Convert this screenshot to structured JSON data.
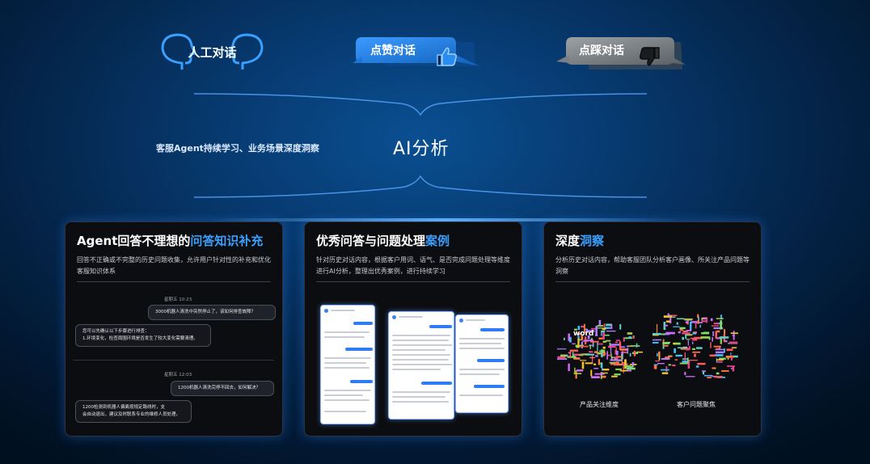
{
  "top": {
    "human_label": "人工对话",
    "like_label": "点赞对话",
    "dislike_label": "点踩对话"
  },
  "middle": {
    "agent_caption": "客服Agent持续学习、业务场景深度洞察",
    "ai_title": "AI分析"
  },
  "cards": [
    {
      "title_plain": "Agent回答不理想的",
      "title_highlight": "问答知识补充",
      "desc": "回答不正确或不完整的历史问题收集，允许用户针对性的补充和优化客服知识体系",
      "chat": {
        "time1": "星期五 10:23",
        "user1": "3000机器人清洗中突然停止了，该如何排查故障？",
        "bot1_line1": "您可以先确认以下步骤进行排查：",
        "bot1_line2": "1.环境变化，检查周围环境是否发生了较大变化需要清理。",
        "time2": "星期五 12:03",
        "user2": "1200机器人清洗完停不回去，如何解决？",
        "bot2_line1": "1200检测到机器人偏离按规定路线时，支",
        "bot2_line2": "会自动退出，建议及时联系专业的维修人员处理。"
      }
    },
    {
      "title_plain": "优秀问答与问题处理",
      "title_highlight": "案例",
      "desc": "针对历史对话内容，根据客户用词、语气、是否完成问题处理等维度进行AI分析，整理出优秀案例，进行持续学习"
    },
    {
      "title_plain": "深度",
      "title_highlight": "洞察",
      "desc": "分析历史对话内容，帮助客服团队分析客户画像、所关注产品问题等洞察",
      "cloud1_label": "产品关注维度",
      "cloud2_label": "客户问题聚焦",
      "cloud_word": "word"
    }
  ],
  "colors": {
    "accent": "#3aa0ff",
    "card_bg": "#0c0d10",
    "like_bubble": "#1a78d8",
    "dislike_bubble": "#6e7378"
  },
  "icons": {
    "human": "head-profile-icon",
    "like": "thumbs-up-icon",
    "dislike": "thumbs-down-icon"
  }
}
